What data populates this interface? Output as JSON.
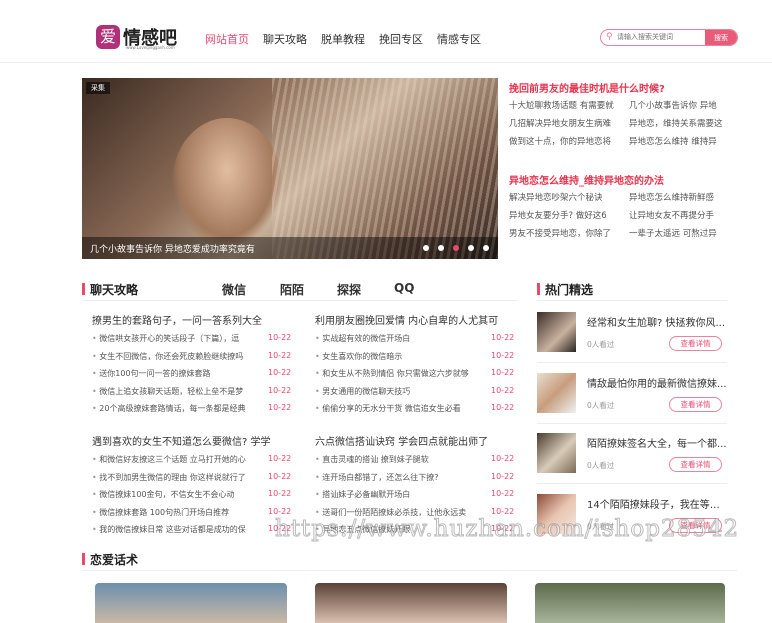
{
  "header": {
    "logo_mark": "爱",
    "logo_text": "情感吧",
    "logo_sub": "www.Loveqingganh.com",
    "nav": [
      "网站首页",
      "聊天攻略",
      "脱单教程",
      "挽回专区",
      "情感专区"
    ],
    "search_placeholder": "请输入搜索关键词",
    "search_button": "搜索"
  },
  "banner": {
    "tag": "采集",
    "caption": "几个小故事告诉你 异地恋爱成功率究竟有",
    "slide_count": 5,
    "active_slide": 3
  },
  "right_top": [
    {
      "title": "挽回前男友的最佳时机是什么时候?",
      "items": [
        "十大尬聊救场话题 有需要就",
        "几个小故事告诉你 异地",
        "几招解决异地女朋友生病难",
        "异地恋，维持关系需要这",
        "做到这十点，你的异地恋将",
        "异地恋怎么维持 维持异"
      ]
    },
    {
      "title": "异地恋怎么维持_维持异地恋的办法",
      "items": [
        "解决异地恋吵架六个秘诀",
        "异地恋怎么维持新鲜感",
        "异地女友要分手? 做好这6",
        "让异地女友不再提分手",
        "男友不接受异地恋，你除了",
        "一辈子太遥远 可熬过异"
      ]
    }
  ],
  "chat": {
    "title": "聊天攻略",
    "tabs": [
      "微信",
      "陌陌",
      "探探",
      "QQ"
    ],
    "groups": [
      {
        "title": "撩男生的套路句子，一问一答系列大全",
        "items": [
          {
            "t": "微信哄女孩开心的笑话段子（下篇），逗",
            "d": "10-22"
          },
          {
            "t": "女生不回微信，你还会死皮赖脸继续撩吗",
            "d": "10-22"
          },
          {
            "t": "送你100句一问一答的撩妹套路",
            "d": "10-22"
          },
          {
            "t": "微信上追女孩聊天话题，轻松上垒不是梦",
            "d": "10-22"
          },
          {
            "t": "20个高级撩妹套路情话，每一条都是经典",
            "d": "10-22"
          }
        ]
      },
      {
        "title": "利用朋友圈挽回爱情 内心自卑的人尤其可",
        "items": [
          {
            "t": "实战超有效的微信开场白",
            "d": "10-22"
          },
          {
            "t": "女生喜欢你的微信暗示",
            "d": "10-22"
          },
          {
            "t": "和女生从不熟到情侣 你只需做这六步就够",
            "d": "10-22"
          },
          {
            "t": "男女通用的微信聊天技巧",
            "d": "10-22"
          },
          {
            "t": "偷偷分享的无水分干货 微信追女生必看",
            "d": "10-22"
          }
        ]
      },
      {
        "title": "遇到喜欢的女生不知道怎么要微信? 学学",
        "items": [
          {
            "t": "和微信好友撩这三个话题 立马打开她的心",
            "d": "10-22"
          },
          {
            "t": "找不到加男生微信的理由 你这样说就行了",
            "d": "10-22"
          },
          {
            "t": "微信撩妹100金句，不信女生不会心动",
            "d": "10-22"
          },
          {
            "t": "微信撩妹套路 100句热门开场白推荐",
            "d": "10-22"
          },
          {
            "t": "我的微信撩妹日常 这些对话都是成功的保",
            "d": "10-22"
          }
        ]
      },
      {
        "title": "六点微信搭讪诀窍 学会四点就能出师了",
        "items": [
          {
            "t": "直击灵魂的搭讪 撩到妹子腿软",
            "d": "10-22"
          },
          {
            "t": "连开场白都错了，还怎么往下撩?",
            "d": "10-22"
          },
          {
            "t": "搭讪妹子必备幽默开场白",
            "d": "10-22"
          },
          {
            "t": "送哥们一份陌陌撩妹必杀技，让他永远卖",
            "d": "10-22"
          },
          {
            "t": "异地恋五点微信撩妹开眼",
            "d": "10-22"
          }
        ]
      }
    ]
  },
  "hot": {
    "title": "热门精选",
    "button": "查看详情",
    "items": [
      {
        "t": "经常和女生尬聊? 快拯救你风...",
        "v": "0人看过"
      },
      {
        "t": "情敌最怕你用的最新微信撩妹...",
        "v": "0人看过"
      },
      {
        "t": "陌陌撩妹签名大全，每一个都...",
        "v": "0人看过"
      },
      {
        "t": "14个陌陌撩妹段子，我在等风...",
        "v": "0人看过"
      }
    ]
  },
  "love": {
    "title": "恋爱话术"
  },
  "watermark": "https://www.huzhan.com/ishop28542",
  "colors": {
    "accent": "#e84a6e"
  }
}
